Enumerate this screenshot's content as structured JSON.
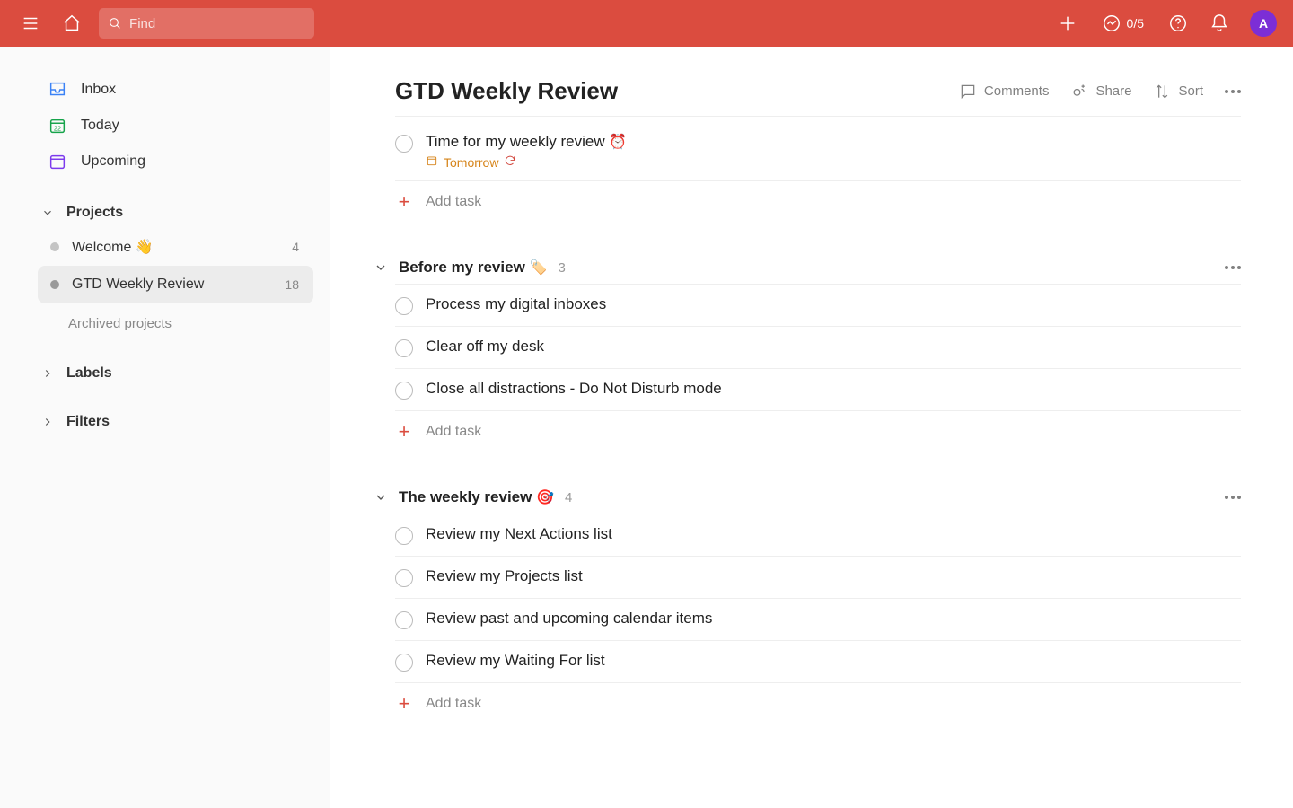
{
  "header": {
    "search_placeholder": "Find",
    "progress": "0/5",
    "avatar_initial": "A"
  },
  "sidebar": {
    "nav": {
      "inbox": "Inbox",
      "today": "Today",
      "upcoming": "Upcoming"
    },
    "sections": {
      "projects": "Projects",
      "labels": "Labels",
      "filters": "Filters"
    },
    "projects": [
      {
        "name": "Welcome",
        "emoji": "👋",
        "count": "4"
      },
      {
        "name": "GTD Weekly Review",
        "emoji": "",
        "count": "18"
      }
    ],
    "archived": "Archived projects"
  },
  "page": {
    "title": "GTD Weekly Review",
    "actions": {
      "comments": "Comments",
      "share": "Share",
      "sort": "Sort"
    },
    "add_task": "Add task",
    "top_tasks": [
      {
        "title": "Time for my weekly review",
        "emoji": "⏰",
        "date": "Tomorrow",
        "recurring": true
      }
    ],
    "sections": [
      {
        "name": "Before my review",
        "emoji": "🏷️",
        "count": "3",
        "tasks": [
          {
            "title": "Process my digital inboxes"
          },
          {
            "title": "Clear off my desk"
          },
          {
            "title": "Close all distractions - Do Not Disturb mode"
          }
        ]
      },
      {
        "name": "The weekly review",
        "emoji": "🎯",
        "count": "4",
        "tasks": [
          {
            "title": "Review my Next Actions list"
          },
          {
            "title": "Review my Projects list"
          },
          {
            "title": "Review past and upcoming calendar items"
          },
          {
            "title": "Review my Waiting For list"
          }
        ]
      }
    ]
  }
}
